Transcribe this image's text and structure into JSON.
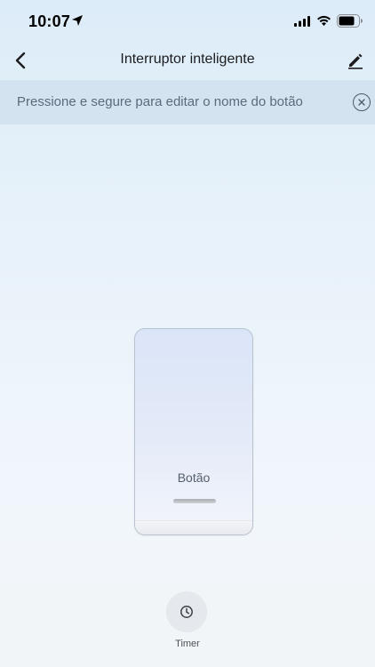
{
  "status_bar": {
    "time": "10:07",
    "location_icon": "location-arrow-icon",
    "signal_icon": "cellular-signal-icon",
    "wifi_icon": "wifi-icon",
    "battery_icon": "battery-icon"
  },
  "nav": {
    "title": "Interruptor inteligente",
    "back_icon": "chevron-left-icon",
    "edit_icon": "pencil-icon"
  },
  "hint": {
    "text": "Pressione e segure para editar o nome do botão",
    "close_icon": "close-circle-icon"
  },
  "switch": {
    "label": "Botão"
  },
  "bottom": {
    "timer_label": "Timer",
    "timer_icon": "clock-icon"
  },
  "colors": {
    "hint_background": "#d3e4f0",
    "hint_text": "#5b6b7c",
    "switch_border": "#b9c3cf"
  }
}
